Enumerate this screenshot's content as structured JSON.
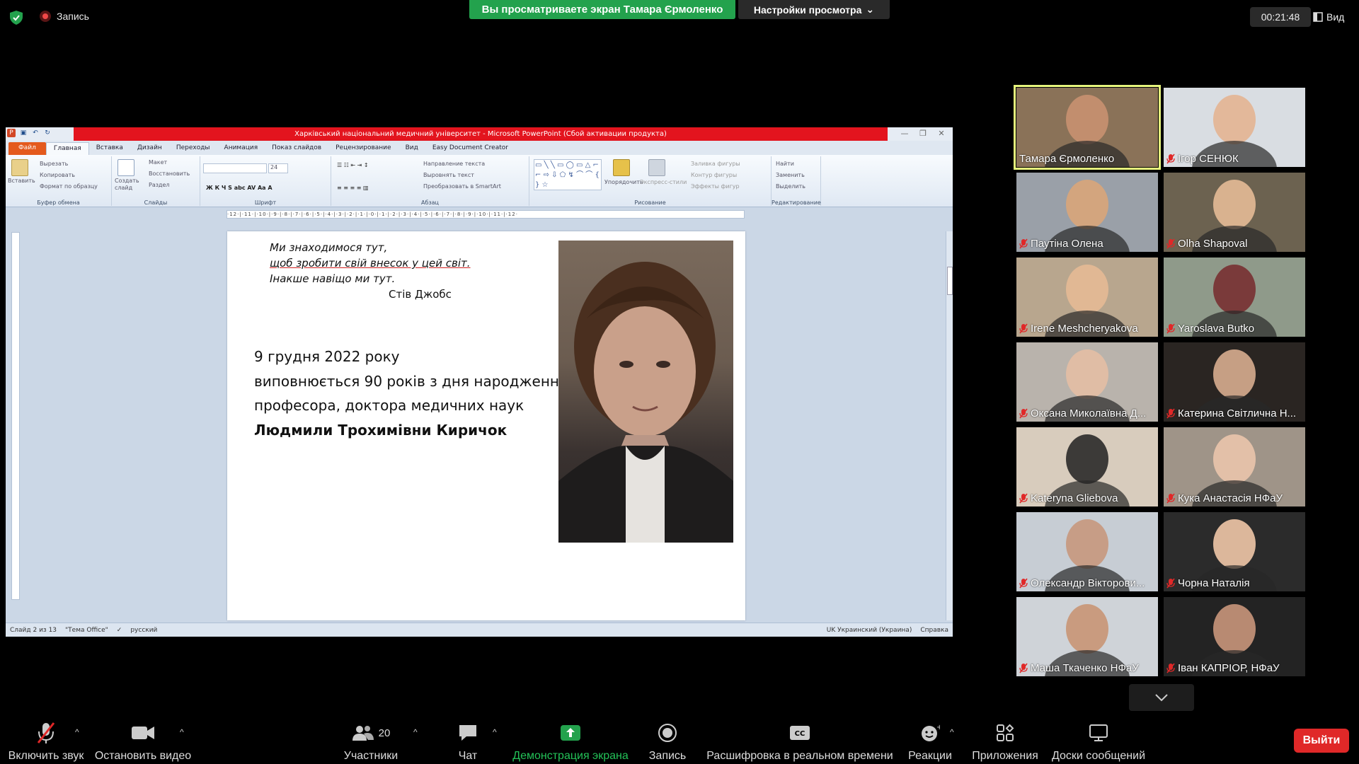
{
  "topbar": {
    "recording_label": "Запись",
    "viewing_banner": "Вы просматриваете экран Тамара Єрмоленко",
    "view_settings": "Настройки просмотра",
    "timer": "00:21:48",
    "view_label": "Вид"
  },
  "ppt": {
    "window_title": "Харківський національний медичний університет - Microsoft PowerPoint (Сбой активации продукта)",
    "tabs": [
      "Файл",
      "Главная",
      "Вставка",
      "Дизайн",
      "Переходы",
      "Анимация",
      "Показ слайдов",
      "Рецензирование",
      "Вид",
      "Easy Document Creator"
    ],
    "ribbon": {
      "paste": "Вставить",
      "cut": "Вырезать",
      "copy": "Копировать",
      "format_painter": "Формат по образцу",
      "clipboard": "Буфер обмена",
      "layout": "Макет",
      "reset": "Восстановить",
      "new_slide": "Создать слайд",
      "section": "Раздел",
      "slides": "Слайды",
      "font_size": "24",
      "font": "Шрифт",
      "text_direction": "Направление текста",
      "align_text": "Выровнять текст",
      "convert_smartart": "Преобразовать в SmartArt",
      "paragraph": "Абзац",
      "arrange": "Упорядочить",
      "quick_styles": "Экспресс-стили",
      "shape_fill": "Заливка фигуры",
      "shape_outline": "Контур фигуры",
      "shape_effects": "Эффекты фигур",
      "drawing": "Рисование",
      "find": "Найти",
      "replace": "Заменить",
      "select": "Выделить",
      "editing": "Редактирование"
    },
    "ruler": "·12·|·11·|·10·|·9·|·8·|·7·|·6·|·5·|·4·|·3·|·2·|·1·|·0·|·1·|·2·|·3·|·4·|·5·|·6·|·7·|·8·|·9·|·10·|·11·|·12·",
    "slide": {
      "quote_line1": "Ми знаходимося тут,",
      "quote_line2": "щоб зробити свій внесок у цей світ.",
      "quote_line3": "Інакше навіщо ми тут.",
      "quote_author": "Стів Джобс",
      "line1": "9 грудня 2022 року",
      "line2": "виповнюється 90 років з дня народження",
      "line3": "професора, доктора медичних наук",
      "line4": "Людмили Трохимівни Киричок"
    },
    "status": {
      "slide_of": "Слайд 2 из 13",
      "theme": "\"Тема Office\"",
      "language": "русский",
      "keyboard": "UK Украинский (Украина)",
      "help": "Справка"
    }
  },
  "participants": [
    {
      "name": "Тамара Єрмоленко",
      "muted": false
    },
    {
      "name": "Ігор СЕНЮК",
      "muted": true
    },
    {
      "name": "Паутіна Олена",
      "muted": true
    },
    {
      "name": "Olha Shapoval",
      "muted": true
    },
    {
      "name": "Irene Meshcheryakova",
      "muted": true
    },
    {
      "name": "Yaroslava Butko",
      "muted": true
    },
    {
      "name": "Оксана Миколаївна Д...",
      "muted": true
    },
    {
      "name": "Катерина Світлична Н...",
      "muted": true
    },
    {
      "name": "Kateryna Gliebova",
      "muted": true
    },
    {
      "name": "Кука Анастасія НФаУ",
      "muted": true
    },
    {
      "name": "Олександр Вікторови...",
      "muted": true
    },
    {
      "name": "Чорна Наталія",
      "muted": true
    },
    {
      "name": "Маша Ткаченко НФаУ",
      "muted": true
    },
    {
      "name": "Іван КАПРІОР, НФаУ",
      "muted": true
    }
  ],
  "toolbar": {
    "unmute": "Включить звук",
    "start_video": "Остановить видео",
    "participants": "Участники",
    "participants_count": "20",
    "chat": "Чат",
    "share_screen": "Демонстрация экрана",
    "record": "Запись",
    "captions": "Расшифровка в реальном времени",
    "reactions": "Реакции",
    "apps": "Приложения",
    "whiteboards": "Доски сообщений",
    "leave": "Выйти"
  },
  "colors": {
    "share_green": "#23a24d",
    "leave_red": "#e02828",
    "active_speaker": "#e6f57c",
    "ppt_title_red": "#e3141e"
  }
}
